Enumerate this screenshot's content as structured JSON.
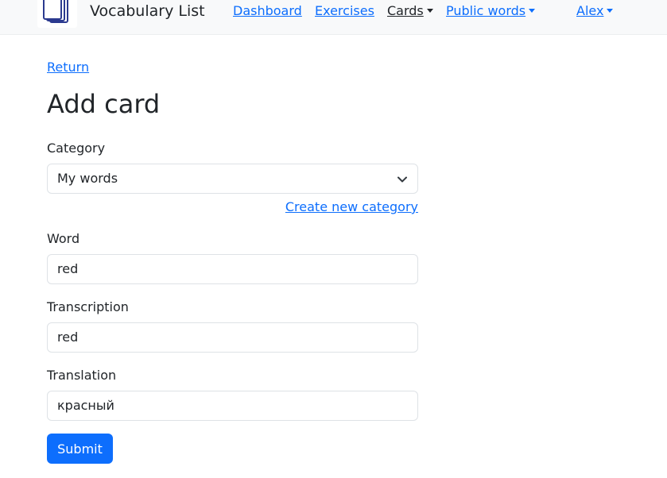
{
  "navbar": {
    "brand": "Vocabulary List",
    "logo_icon": "stacked-cards-icon",
    "links": [
      {
        "label": "Dashboard",
        "active": false,
        "dropdown": false
      },
      {
        "label": "Exercises",
        "active": false,
        "dropdown": false
      },
      {
        "label": "Cards",
        "active": true,
        "dropdown": true
      },
      {
        "label": "Public words",
        "active": false,
        "dropdown": true
      }
    ],
    "user": {
      "label": "Alex",
      "dropdown": true
    }
  },
  "page": {
    "return_label": "Return",
    "title": "Add card"
  },
  "form": {
    "category": {
      "label": "Category",
      "selected": "My words",
      "create_link": "Create new category"
    },
    "word": {
      "label": "Word",
      "value": "red"
    },
    "transcription": {
      "label": "Transcription",
      "value": "red"
    },
    "translation": {
      "label": "Translation",
      "value": "красный"
    },
    "submit_label": "Submit"
  },
  "colors": {
    "accent": "#0d6efd",
    "navbar_bg": "#f8f9fa",
    "text": "#212529",
    "border": "#dee2e6"
  }
}
